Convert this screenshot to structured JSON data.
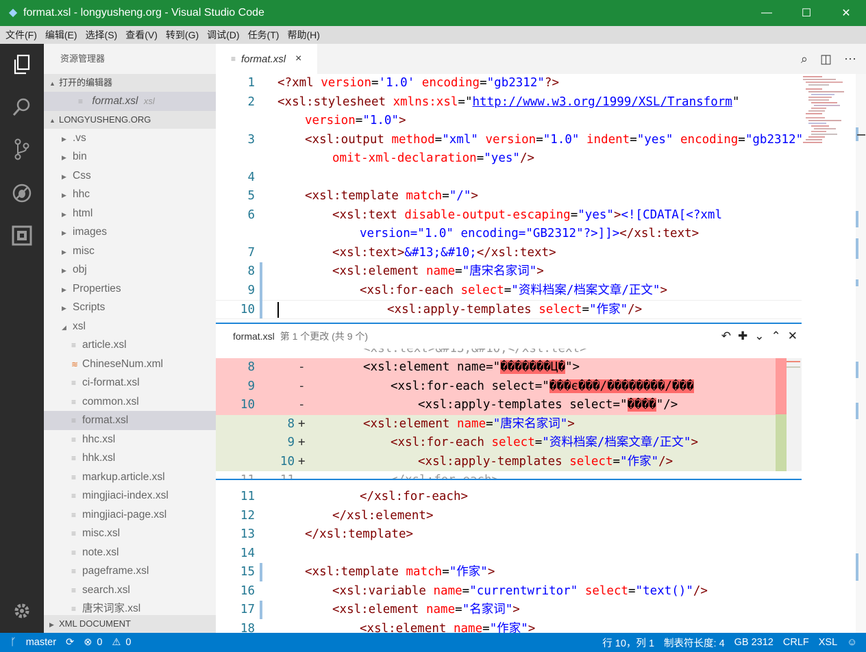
{
  "window": {
    "title": "format.xsl - longyusheng.org - Visual Studio Code",
    "minimize": "—",
    "maximize": "☐",
    "close": "✕"
  },
  "menu": [
    "文件(F)",
    "编辑(E)",
    "选择(S)",
    "查看(V)",
    "转到(G)",
    "调试(D)",
    "任务(T)",
    "帮助(H)"
  ],
  "sidebar": {
    "title": "资源管理器",
    "open_editors_label": "打开的编辑器",
    "open_editor": {
      "name": "format.xsl",
      "hint": "xsl"
    },
    "project_label": "LONGYUSHENG.ORG",
    "folders": [
      ".vs",
      "bin",
      "Css",
      "hhc",
      "html",
      "images",
      "misc",
      "obj",
      "Properties",
      "Scripts",
      "xsl"
    ],
    "files": [
      "article.xsl",
      "ChineseNum.xml",
      "ci-format.xsl",
      "common.xsl",
      "format.xsl",
      "hhc.xsl",
      "hhk.xsl",
      "markup.article.xsl",
      "mingjiaci-index.xsl",
      "mingjiaci-page.xsl",
      "misc.xsl",
      "note.xsl",
      "pageframe.xsl",
      "search.xsl",
      "唐宋词家.xsl"
    ],
    "xml_doc_label": "XML DOCUMENT"
  },
  "tab": {
    "label": "format.xsl",
    "close": "×"
  },
  "code_lines": [
    "1",
    "2",
    "3",
    "4",
    "5",
    "6",
    "7",
    "8",
    "9",
    "10"
  ],
  "code_lines_after": [
    "11",
    "12",
    "13",
    "14",
    "15",
    "16",
    "17",
    "18"
  ],
  "peek": {
    "file": "format.xsl",
    "info": "第 1 个更改 (共 9 个)"
  },
  "status": {
    "branch": "master",
    "errors": "0",
    "warnings": "0",
    "position": "行 10，列 1",
    "tab_size": "制表符长度: 4",
    "encoding": "GB 2312",
    "eol": "CRLF",
    "language": "XSL"
  },
  "colors": {
    "titlebar": "#1e8a3a",
    "statusbar": "#007acc",
    "activitybar": "#2c2c2c",
    "sidebar": "#f3f3f3"
  }
}
